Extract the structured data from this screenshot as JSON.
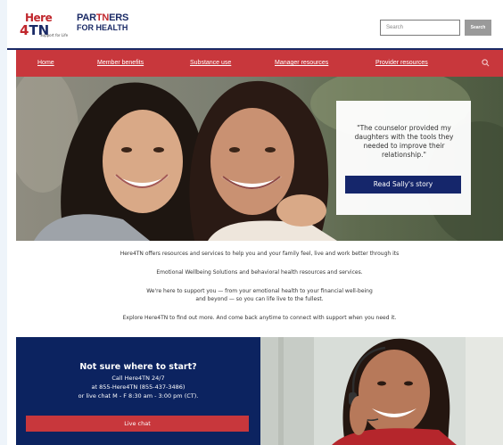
{
  "header": {
    "logo_here_top": "Here",
    "logo_here_num": "4",
    "logo_here_tn": "TN",
    "logo_here_tagline": "Support for Life",
    "logo_partners_part1": "PAR",
    "logo_partners_tn": "TN",
    "logo_partners_part2": "ERS",
    "logo_partners_line2": "FOR HEALTH",
    "search_placeholder": "Search",
    "search_button": "Search"
  },
  "nav": {
    "items": [
      "Home",
      "Member benefits",
      "Substance use",
      "Manager resources",
      "Provider resources"
    ],
    "search_icon": "search-icon"
  },
  "hero": {
    "quote": "\"The counselor provided my daughters with the tools they needed to improve their relationship.\"",
    "button": "Read Sally's story"
  },
  "intro": {
    "p1": "Here4TN offers resources and services to help you and your family feel, live and work better through its",
    "p2": "Emotional Wellbeing Solutions and behavioral health resources and services.",
    "p3a": "We're here to support you — from your emotional health to your financial well-being",
    "p3b": "and beyond — so you can life live to the fullest.",
    "p4": "Explore Here4TN to find out more. And come back anytime to connect with support when you need it."
  },
  "cta": {
    "title": "Not sure where to start?",
    "line1": "Call Here4TN 24/7",
    "line2": "at 855-Here4TN (855-437-3486)",
    "line3": "or live chat M - F 8:30 am - 3:00 pm (CT).",
    "button": "Live chat"
  },
  "colors": {
    "navy": "#15266b",
    "red": "#c8373c",
    "cta_bg": "#0c2360"
  }
}
